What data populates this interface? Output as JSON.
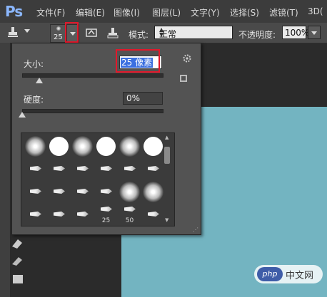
{
  "app": {
    "logo_text": "Ps"
  },
  "menu": {
    "items": [
      "文件(F)",
      "编辑(E)",
      "图像(I)",
      "图层(L)",
      "文字(Y)",
      "选择(S)",
      "滤镜(T)",
      "3D("
    ]
  },
  "options_bar": {
    "tool_icon": "clone-stamp-icon",
    "brush_size_preview": "25",
    "mode_label": "模式:",
    "mode_value": "正常",
    "opacity_label": "不透明度:",
    "opacity_value": "100%"
  },
  "brush_panel": {
    "size_label": "大小:",
    "size_value": "25 像素",
    "size_slider_fraction": 0.12,
    "hardness_label": "硬度:",
    "hardness_value": "0%",
    "hardness_slider_fraction": 0.0,
    "presets": [
      {
        "type": "soft"
      },
      {
        "type": "hard"
      },
      {
        "type": "soft"
      },
      {
        "type": "hard"
      },
      {
        "type": "soft"
      },
      {
        "type": "hard"
      },
      {
        "type": "stroke"
      },
      {
        "type": "stroke"
      },
      {
        "type": "stroke"
      },
      {
        "type": "stroke"
      },
      {
        "type": "stroke"
      },
      {
        "type": "stroke"
      },
      {
        "type": "stroke"
      },
      {
        "type": "stroke"
      },
      {
        "type": "stroke"
      },
      {
        "type": "stroke"
      },
      {
        "type": "soft"
      },
      {
        "type": "soft"
      },
      {
        "type": "stroke"
      },
      {
        "type": "stroke"
      },
      {
        "type": "stroke"
      },
      {
        "type": "stroke",
        "label": "25"
      },
      {
        "type": "stroke",
        "label": "50"
      },
      {
        "type": "stroke"
      }
    ]
  },
  "highlight_color": "#e2182b",
  "canvas_color": "#73b4c1",
  "watermark": {
    "logo": "php",
    "text": "中文网"
  }
}
